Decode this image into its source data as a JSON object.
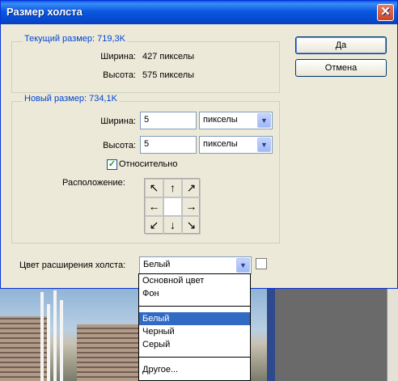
{
  "dialog": {
    "title": "Размер холста",
    "close_glyph": "✕",
    "ok_label": "Да",
    "cancel_label": "Отмена"
  },
  "current_size": {
    "title": "Текущий размер: 719,3K",
    "width_label": "Ширина:",
    "width_value": "427 пикселы",
    "height_label": "Высота:",
    "height_value": "575 пикселы"
  },
  "new_size": {
    "title": "Новый размер: 734,1K",
    "width_label": "Ширина:",
    "width_value": "5",
    "width_unit": "пикселы",
    "height_label": "Высота:",
    "height_value": "5",
    "height_unit": "пикселы",
    "relative_label": "Относительно",
    "relative_checked": true,
    "anchor_label": "Расположение:",
    "anchor_arrows": [
      "↖",
      "↑",
      "↗",
      "←",
      "",
      "→",
      "↙",
      "↓",
      "↘"
    ]
  },
  "extension": {
    "label": "Цвет расширения холста:",
    "selected": "Белый",
    "swatch_color": "#ffffff",
    "options_group1": [
      "Основной цвет",
      "Фон"
    ],
    "options_group2": [
      "Белый",
      "Черный",
      "Серый"
    ],
    "options_group3": [
      "Другое..."
    ]
  },
  "icons": {
    "dropdown_arrow": "▼"
  }
}
